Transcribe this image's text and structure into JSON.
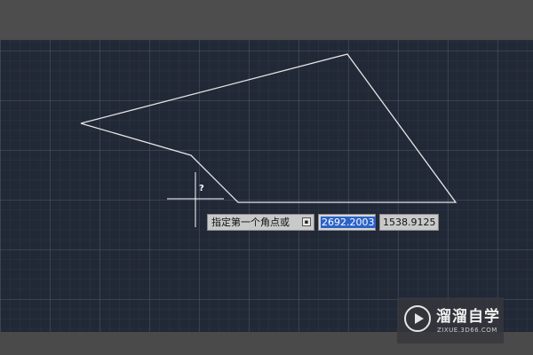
{
  "command_prompt": {
    "text": "指定第一个角点或",
    "dropdown_glyph": "▪"
  },
  "coordinates": {
    "x_value": "2692.2003",
    "y_value": "1538.9125"
  },
  "cursor": {
    "tooltip_glyph": "?"
  },
  "watermark": {
    "title": "溜溜自学",
    "subtitle": "ZIXUE.3D66.COM"
  },
  "colors": {
    "canvas_bg": "#212836",
    "line_color": "#e6e6e6",
    "selection": "#2c63c7",
    "frame_gray": "#4b4b4b"
  }
}
